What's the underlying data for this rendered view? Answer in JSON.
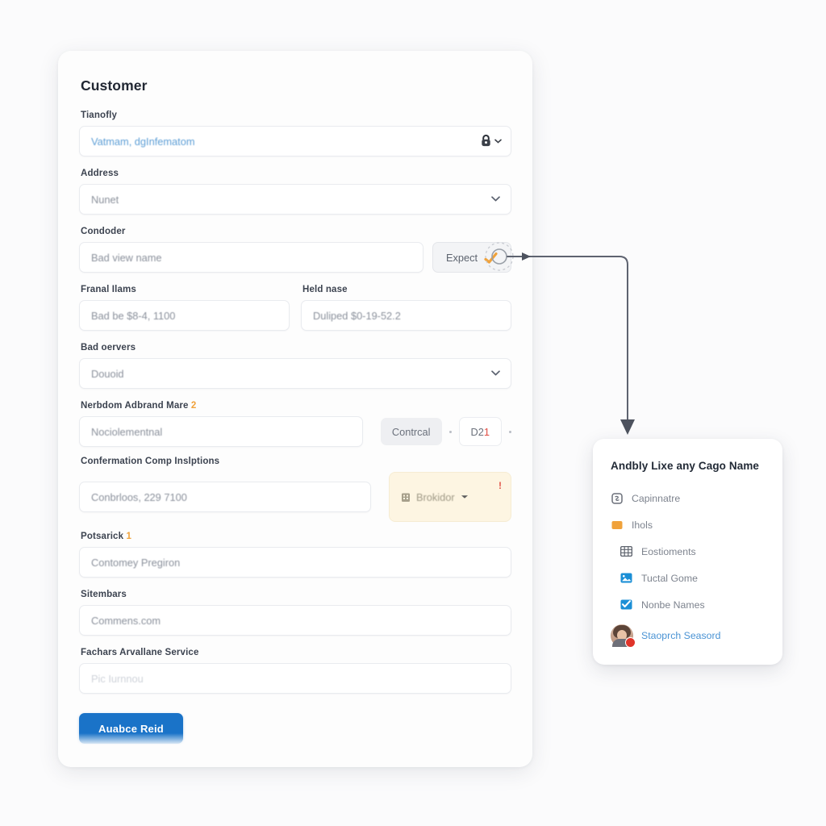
{
  "colors": {
    "page_bg": "#fbfbfc",
    "card_bg": "#fdfdfd",
    "accent_blue": "#1a73c8",
    "link_blue": "#4a93d4",
    "warn_bg": "#fdf5e2",
    "warn_orange": "#f0a23b",
    "danger_red": "#e0342a",
    "label_text": "#3c4350",
    "value_text": "#8b919c"
  },
  "form_card": {
    "title": "Customer",
    "submit_button": "Auabce Reid",
    "fields": [
      {
        "label": "Tianofly",
        "value": "Vatmam, dgInfematom",
        "style": "link",
        "trailing_icon": "lock-icon",
        "trailing_caret": true
      },
      {
        "label": "Address",
        "value": "Nunet",
        "style": "normal",
        "trailing_caret": true
      },
      {
        "label": "Condoder",
        "value": "Bad view name",
        "style": "normal",
        "action_button": {
          "label": "Expect",
          "icon": "pencil-check-icon"
        }
      }
    ],
    "name_row": {
      "left": {
        "label": "Franal Ilams",
        "value": "Bad be $8-4, 1100"
      },
      "right": {
        "label": "Held nase",
        "value": "Duliped $0-19-52.2"
      }
    },
    "servers_field": {
      "label": "Bad oervers",
      "value": "Douoid",
      "trailing_caret": true
    },
    "chips_field": {
      "label": "Nerbdom Adbrand Mare",
      "required_mark": "2",
      "value": "Nociolementnal",
      "chips": [
        {
          "label": "Contrcal",
          "style": "solid"
        },
        {
          "label": "D2",
          "suffix": "1",
          "style": "outline"
        }
      ]
    },
    "warn_field": {
      "label": "Confermation Comp Inslptions",
      "value": "Conbrloos, 229 7100",
      "warn_chip": {
        "icon": "building-icon",
        "label": "Brokidor",
        "caret": true,
        "alert": "!"
      }
    },
    "tail_fields": [
      {
        "label": "Potsarick",
        "required_mark": "1",
        "value": "Contomey Pregiron"
      },
      {
        "label": "Sitembars",
        "value": "Commens.com"
      },
      {
        "label": "Fachars Arvallane Service",
        "value": "Pic Iurnnou",
        "faded": true
      }
    ]
  },
  "menu_card": {
    "title": "Andbly Lixe any Cago Name",
    "items": [
      {
        "label": "Capinnatre",
        "icon": "badge-icon",
        "icon_color": "#6a6f79",
        "indent": false
      },
      {
        "label": "Ihols",
        "icon": "orange-square-icon",
        "icon_color": "#f0a23b",
        "indent": false
      },
      {
        "label": "Eostioments",
        "icon": "grid-icon",
        "icon_color": "#5f646e",
        "indent": true
      },
      {
        "label": "Tuctal Gome",
        "icon": "image-icon",
        "icon_color": "#1b8fd6",
        "indent": true
      },
      {
        "label": "Nonbe Names",
        "icon": "check-square-icon",
        "icon_color": "#1b8fd6",
        "indent": true
      }
    ],
    "footer_link": {
      "label": "Staoprch Seasord",
      "avatar": "user-avatar",
      "badge": "notification-badge"
    }
  },
  "connector": {
    "source_node": "dashed-circle-node",
    "arrow_label": ""
  }
}
